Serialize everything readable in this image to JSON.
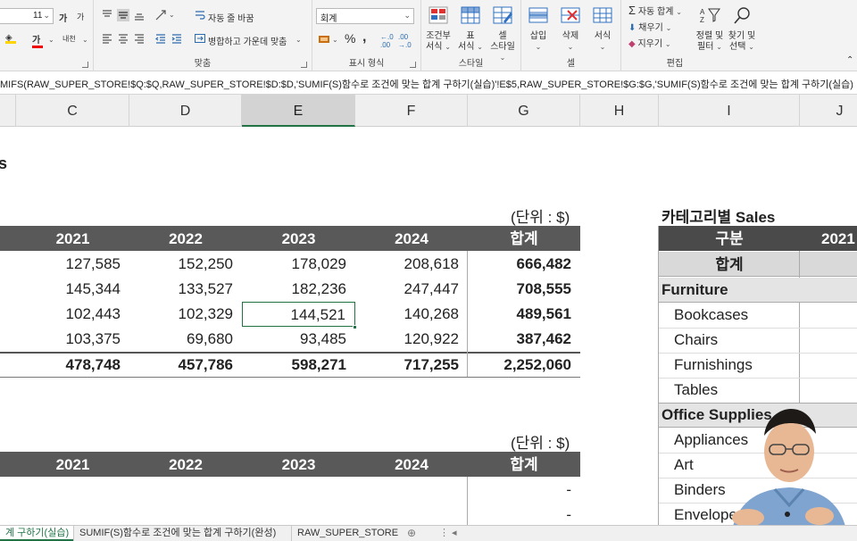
{
  "ribbon": {
    "font_size": "11",
    "grow_font": "가",
    "shrink_font": "가",
    "bold_label": "가",
    "wrap_text": "자동 줄 바꿈",
    "merge_center": "병합하고 가운데 맞춤",
    "number_format": "회계",
    "percent": "%",
    "comma": ",",
    "alignment_group": "맞춤",
    "number_group": "표시 형식",
    "style_group": "스타일",
    "cell_group": "셀",
    "edit_group": "편집",
    "conditional_format": [
      "조건부",
      "서식"
    ],
    "format_as_table": [
      "표",
      "서식"
    ],
    "cell_styles": [
      "셀",
      "스타일"
    ],
    "insert": "삽입",
    "delete": "삭제",
    "format": "서식",
    "autosum": "자동 합계",
    "fill": "채우기",
    "clear": "지우기",
    "sort_filter": [
      "정렬 및",
      "필터"
    ],
    "find_select": [
      "찾기 및",
      "선택"
    ]
  },
  "formula_bar": {
    "text": "MIFS(RAW_SUPER_STORE!$Q:$Q,RAW_SUPER_STORE!$D:$D,'SUMIF(S)함수로 조건에 맞는 합계 구하기(실습)'!E$5,RAW_SUPER_STORE!$G:$G,'SUMIF(S)함수로 조건에 맞는 합계 구하기(실습)"
  },
  "columns": [
    "C",
    "D",
    "E",
    "F",
    "G",
    "H",
    "I",
    "J"
  ],
  "selected_column": "E",
  "sheet": {
    "partial_title": "s",
    "unit1": "(단위 : $)",
    "unit2": "(단위 : $)",
    "table1": {
      "headers": [
        "2021",
        "2022",
        "2023",
        "2024",
        "합계"
      ],
      "rows": [
        [
          "127,585",
          "152,250",
          "178,029",
          "208,618",
          "666,482"
        ],
        [
          "145,344",
          "133,527",
          "182,236",
          "247,447",
          "708,555"
        ],
        [
          "102,443",
          "102,329",
          "144,521",
          "140,268",
          "489,561"
        ],
        [
          "103,375",
          "69,680",
          "93,485",
          "120,922",
          "387,462"
        ]
      ],
      "total": [
        "478,748",
        "457,786",
        "598,271",
        "717,255",
        "2,252,060"
      ]
    },
    "table2": {
      "headers": [
        "2021",
        "2022",
        "2023",
        "2024",
        "합계"
      ],
      "rows": [
        [
          "-"
        ],
        [
          "-"
        ]
      ]
    },
    "right_table": {
      "title": "카테고리별 Sales",
      "header_col": "구분",
      "header_year": "2021",
      "total_label": "합계",
      "items": [
        {
          "label": "Furniture",
          "bold": true
        },
        {
          "label": "Bookcases"
        },
        {
          "label": "Chairs"
        },
        {
          "label": "Furnishings"
        },
        {
          "label": "Tables"
        },
        {
          "label": "Office Supplies",
          "bold": true
        },
        {
          "label": "Appliances"
        },
        {
          "label": "Art"
        },
        {
          "label": "Binders"
        },
        {
          "label": "Envelopes"
        }
      ]
    }
  },
  "tabs": [
    "계 구하기(실습)",
    "SUMIF(S)함수로 조건에 맞는 합계 구하기(완성)",
    "RAW_SUPER_STORE"
  ],
  "colors": {
    "header_bg": "#595959",
    "excel_green": "#217346",
    "right_header_bg": "#4a4a4a",
    "total_row_bg": "#d9d9d9"
  }
}
